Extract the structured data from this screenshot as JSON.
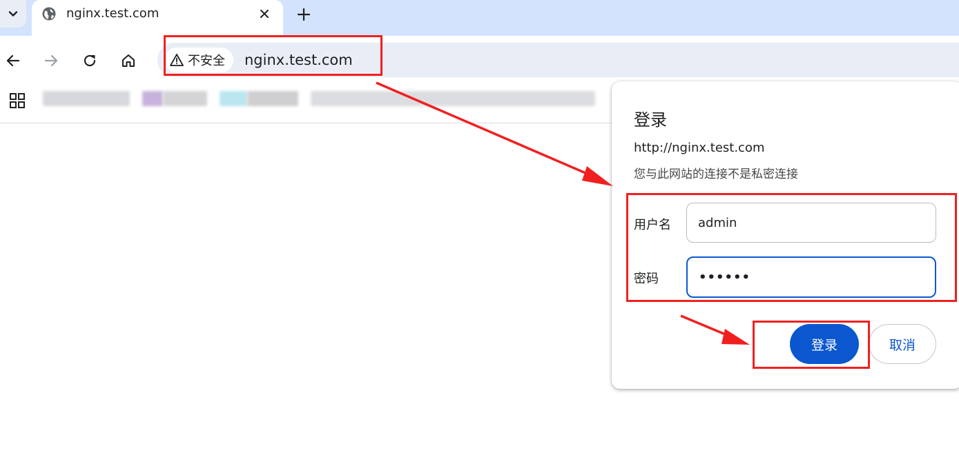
{
  "tab": {
    "title": "nginx.test.com",
    "favicon": "globe-icon",
    "close_icon": "close-icon"
  },
  "toolbar": {
    "security_label": "不安全",
    "url": "nginx.test.com"
  },
  "bookmarks_bar": {
    "apps_icon": "apps-grid-icon",
    "items_blurred": true
  },
  "dialog": {
    "title": "登录",
    "url": "http://nginx.test.com",
    "warning": "您与此网站的连接不是私密连接",
    "username_label": "用户名",
    "username_value": "admin",
    "password_label": "密码",
    "password_value": "••••••",
    "ok_label": "登录",
    "cancel_label": "取消"
  },
  "colors": {
    "accent": "#0b57d0",
    "tabstrip": "#d3e3fd",
    "omnibox": "#e9eef6",
    "annotation_red": "#f0201f"
  }
}
